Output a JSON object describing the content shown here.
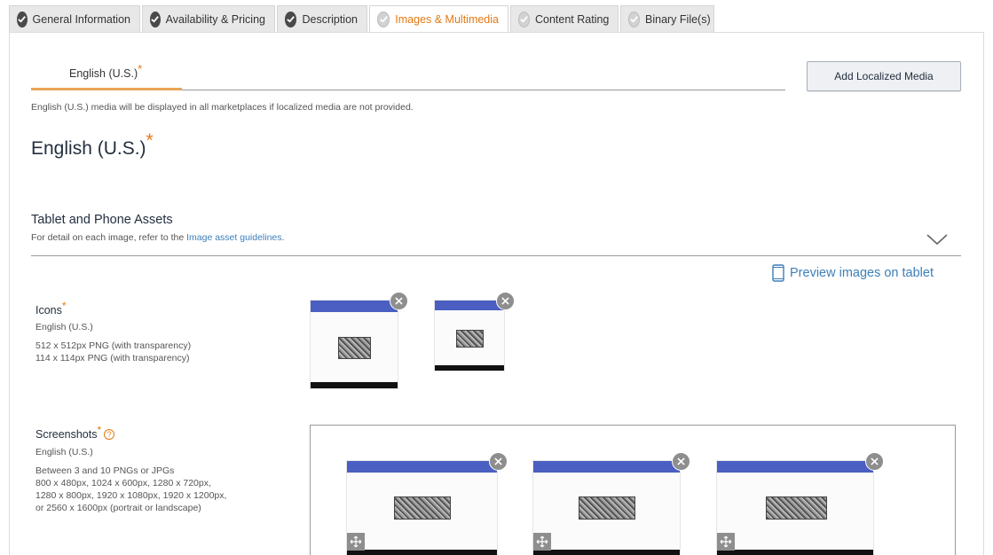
{
  "tabs": [
    {
      "label": "General Information",
      "status": "done"
    },
    {
      "label": "Availability & Pricing",
      "status": "done"
    },
    {
      "label": "Description",
      "status": "done"
    },
    {
      "label": "Images & Multimedia",
      "status": "pending",
      "active": true
    },
    {
      "label": "Content Rating",
      "status": "pending"
    },
    {
      "label": "Binary File(s)",
      "status": "pending"
    }
  ],
  "locale": {
    "tab_label": "English (U.S.)",
    "required_mark": "*",
    "add_button": "Add Localized Media",
    "note": "English (U.S.) media will be displayed in all marketplaces if localized media are not provided.",
    "heading": "English (U.S.)"
  },
  "assets": {
    "title": "Tablet and Phone Assets",
    "sub_prefix": "For detail on each image, refer to the ",
    "sub_link": "Image asset guidelines",
    "sub_suffix": ".",
    "preview_link": "Preview images on tablet"
  },
  "icons": {
    "label": "Icons",
    "locale": "English (U.S.)",
    "spec1": "512 x 512px PNG (with transparency)",
    "spec2": "114 x 114px PNG (with transparency)"
  },
  "screenshots": {
    "label": "Screenshots",
    "locale": "English (U.S.)",
    "spec1": "Between 3 and 10 PNGs or JPGs",
    "spec2": "800 x 480px, 1024 x 600px, 1280 x 720px,",
    "spec3": "1280 x 800px, 1920 x 1080px, 1920 x 1200px,",
    "spec4": "or 2560 x 1600px (portrait or landscape)"
  },
  "colors": {
    "accent": "#e47911",
    "link": "#3d7fb8",
    "app_bar": "#4a5fc1"
  },
  "icon_names": {
    "tab_done": "check-circle-icon",
    "tab_pending": "check-circle-outline-icon",
    "remove": "close-icon",
    "reorder": "move-icon",
    "preview": "tablet-icon",
    "expand": "chevron-down-icon",
    "help": "help-icon"
  }
}
